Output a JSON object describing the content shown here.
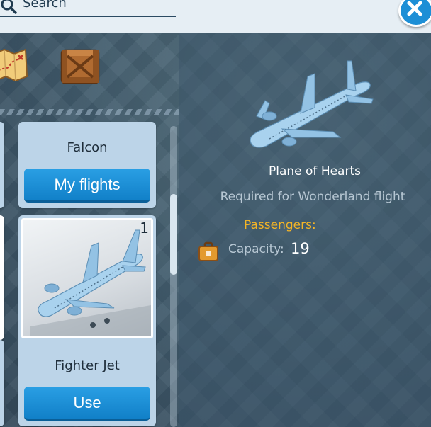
{
  "search": {
    "label": "Search"
  },
  "categories": [
    {
      "icon": "treasure-map-icon"
    },
    {
      "icon": "wooden-crate-icon"
    }
  ],
  "list": {
    "items": [
      {
        "name": "Falcon",
        "button_label": "My flights"
      },
      {
        "name": "Fighter Jet",
        "count": "1",
        "button_label": "Use"
      }
    ]
  },
  "details": {
    "name": "Plane of Hearts",
    "requirement": "Required for Wonderland flight",
    "passengers_label": "Passengers:",
    "capacity_label": "Capacity:",
    "capacity_value": "19"
  },
  "colors": {
    "accent": "#1d8fd6",
    "button": "#1a8fd8",
    "highlight": "#f5b526",
    "card": "#bcd4e8"
  }
}
